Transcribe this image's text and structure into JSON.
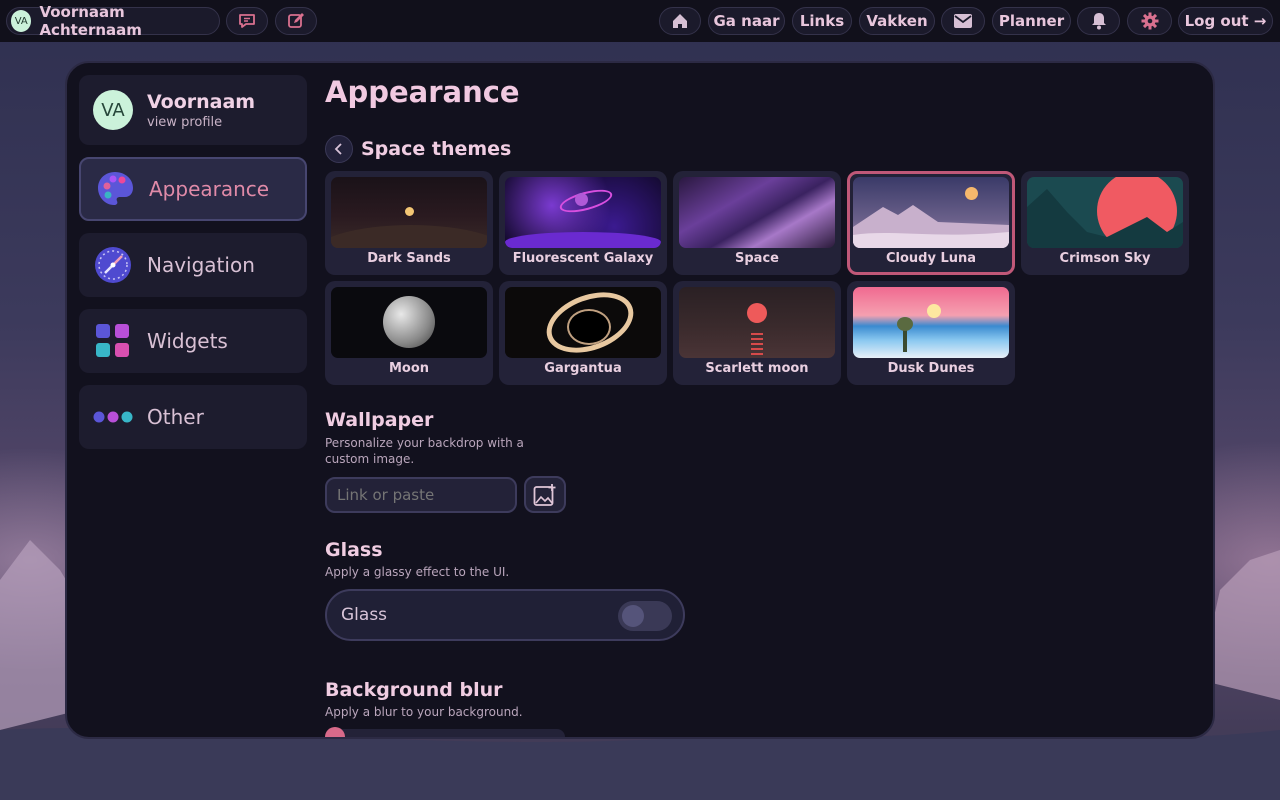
{
  "topbar": {
    "user_initials": "VA",
    "user_name": "Voornaam Achternaam",
    "nav": {
      "ga_naar": "Ga naar",
      "links": "Links",
      "vakken": "Vakken",
      "planner": "Planner",
      "logout": "Log out →"
    }
  },
  "sidebar": {
    "profile": {
      "initials": "VA",
      "name": "Voornaam",
      "subtitle": "view profile"
    },
    "items": [
      {
        "label": "Appearance",
        "icon": "palette-icon",
        "active": true
      },
      {
        "label": "Navigation",
        "icon": "compass-icon",
        "active": false
      },
      {
        "label": "Widgets",
        "icon": "widgets-grid-icon",
        "active": false
      },
      {
        "label": "Other",
        "icon": "dots-icon",
        "active": false
      }
    ]
  },
  "main": {
    "title": "Appearance",
    "themes_title": "Space themes",
    "themes": [
      {
        "name": "Dark Sands",
        "selected": false
      },
      {
        "name": "Fluorescent Galaxy",
        "selected": false
      },
      {
        "name": "Space",
        "selected": false
      },
      {
        "name": "Cloudy Luna",
        "selected": true
      },
      {
        "name": "Crimson Sky",
        "selected": false
      },
      {
        "name": "Moon",
        "selected": false
      },
      {
        "name": "Gargantua",
        "selected": false
      },
      {
        "name": "Scarlett moon",
        "selected": false
      },
      {
        "name": "Dusk Dunes",
        "selected": false
      }
    ],
    "wallpaper": {
      "title": "Wallpaper",
      "description_line1": "Personalize your backdrop with a",
      "description_line2": "custom image.",
      "placeholder": "Link or paste"
    },
    "glass": {
      "title": "Glass",
      "description": "Apply a glassy effect to the UI.",
      "toggle_label": "Glass",
      "enabled": false
    },
    "blur": {
      "title": "Background blur",
      "description": "Apply a blur to your background.",
      "value": 0
    }
  },
  "colors": {
    "accent": "#d86a8a",
    "panel": "#12111e",
    "card": "#1d1c2e",
    "text": "#e6c8de"
  }
}
